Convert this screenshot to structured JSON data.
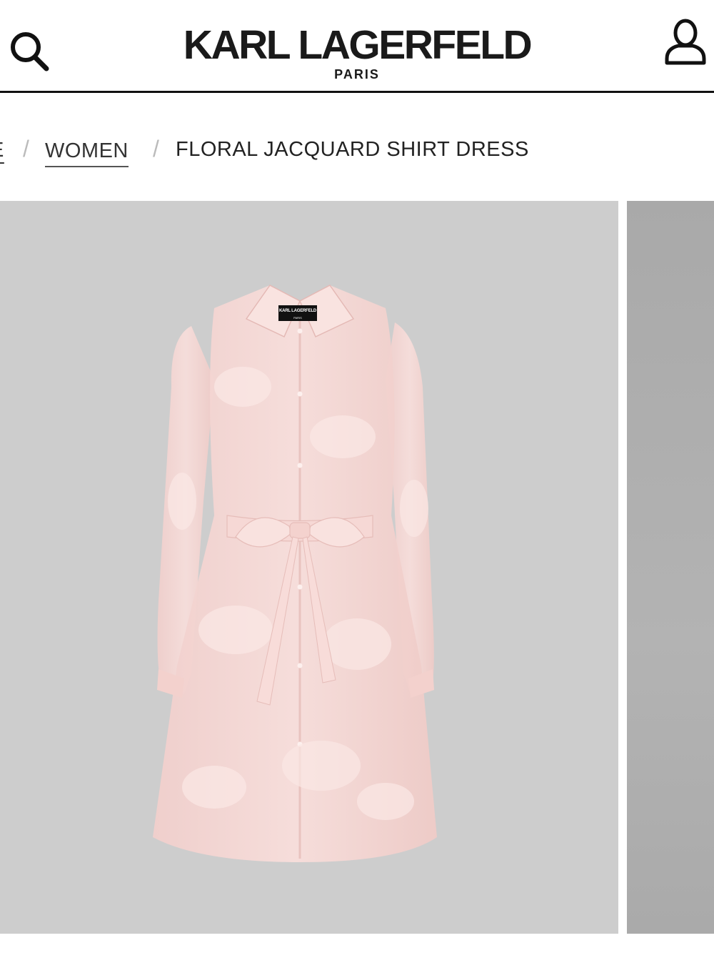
{
  "header": {
    "brand_name": "KARL LAGERFELD",
    "brand_sub": "PARIS",
    "search_icon": "search-icon",
    "account_icon": "user-icon"
  },
  "breadcrumb": {
    "partial_item": "E",
    "separator": "/",
    "women_label": "WOMEN",
    "current_label": "FLORAL JACQUARD SHIRT DRESS"
  },
  "product_gallery": {
    "label_text": "KARL LAGERFELD",
    "label_sub": "PARIS",
    "background_color": "#cdcdcd",
    "dress_color": "#f6d6d3"
  }
}
